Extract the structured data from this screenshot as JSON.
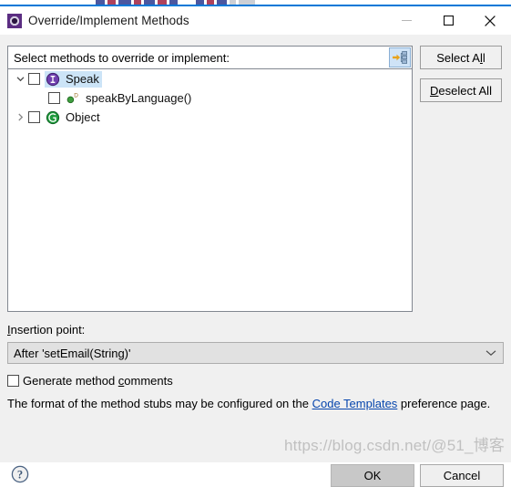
{
  "window": {
    "title": "Override/Implement Methods",
    "icon": "eclipse-dialog-icon",
    "controls": {
      "minimize": "minimize-icon",
      "maximize": "maximize-icon",
      "close": "close-icon"
    }
  },
  "tree_header": {
    "label": "Select methods to override or implement:",
    "toggle_icon": "show-hierarchy-icon"
  },
  "tree": {
    "rows": [
      {
        "label": "Speak",
        "icon": "interface-icon",
        "twisty": "chevron-down",
        "checked": false,
        "selected": true,
        "indent": 1
      },
      {
        "label": "speakByLanguage()",
        "icon": "default-method-icon",
        "twisty": "",
        "checked": false,
        "selected": false,
        "indent": 2
      },
      {
        "label": "Object",
        "icon": "class-icon",
        "twisty": "chevron-right",
        "checked": false,
        "selected": false,
        "indent": 1
      }
    ]
  },
  "side_buttons": {
    "select_all": {
      "pre": "Select A",
      "mnemonic": "l",
      "post": "l"
    },
    "deselect_all": {
      "pre": "",
      "mnemonic": "D",
      "post": "eselect All"
    }
  },
  "insertion": {
    "label_pre": "",
    "label_mnemonic": "I",
    "label_post": "nsertion point:",
    "value": "After 'setEmail(String)'",
    "arrow_icon": "chevron-down-icon"
  },
  "generate_comments": {
    "pre": "Generate method ",
    "mnemonic": "c",
    "post": "omments",
    "checked": false
  },
  "format_note": {
    "before": "The format of the method stubs may be configured on the ",
    "link": "Code Templates",
    "after": " preference page."
  },
  "bottom": {
    "help_icon": "help-icon",
    "ok": "OK",
    "cancel": "Cancel"
  },
  "watermark": {
    "text": "https://blog.csdn.net/@51_博客"
  },
  "colors": {
    "accent": "#0078d7",
    "selection": "#cce4f7",
    "link": "#0645ad",
    "interface_icon": "#6a3fa0",
    "class_icon": "#1e9a3c",
    "method_icon": "#3a9a3a",
    "dialog_bg": "#f0f0f0"
  }
}
